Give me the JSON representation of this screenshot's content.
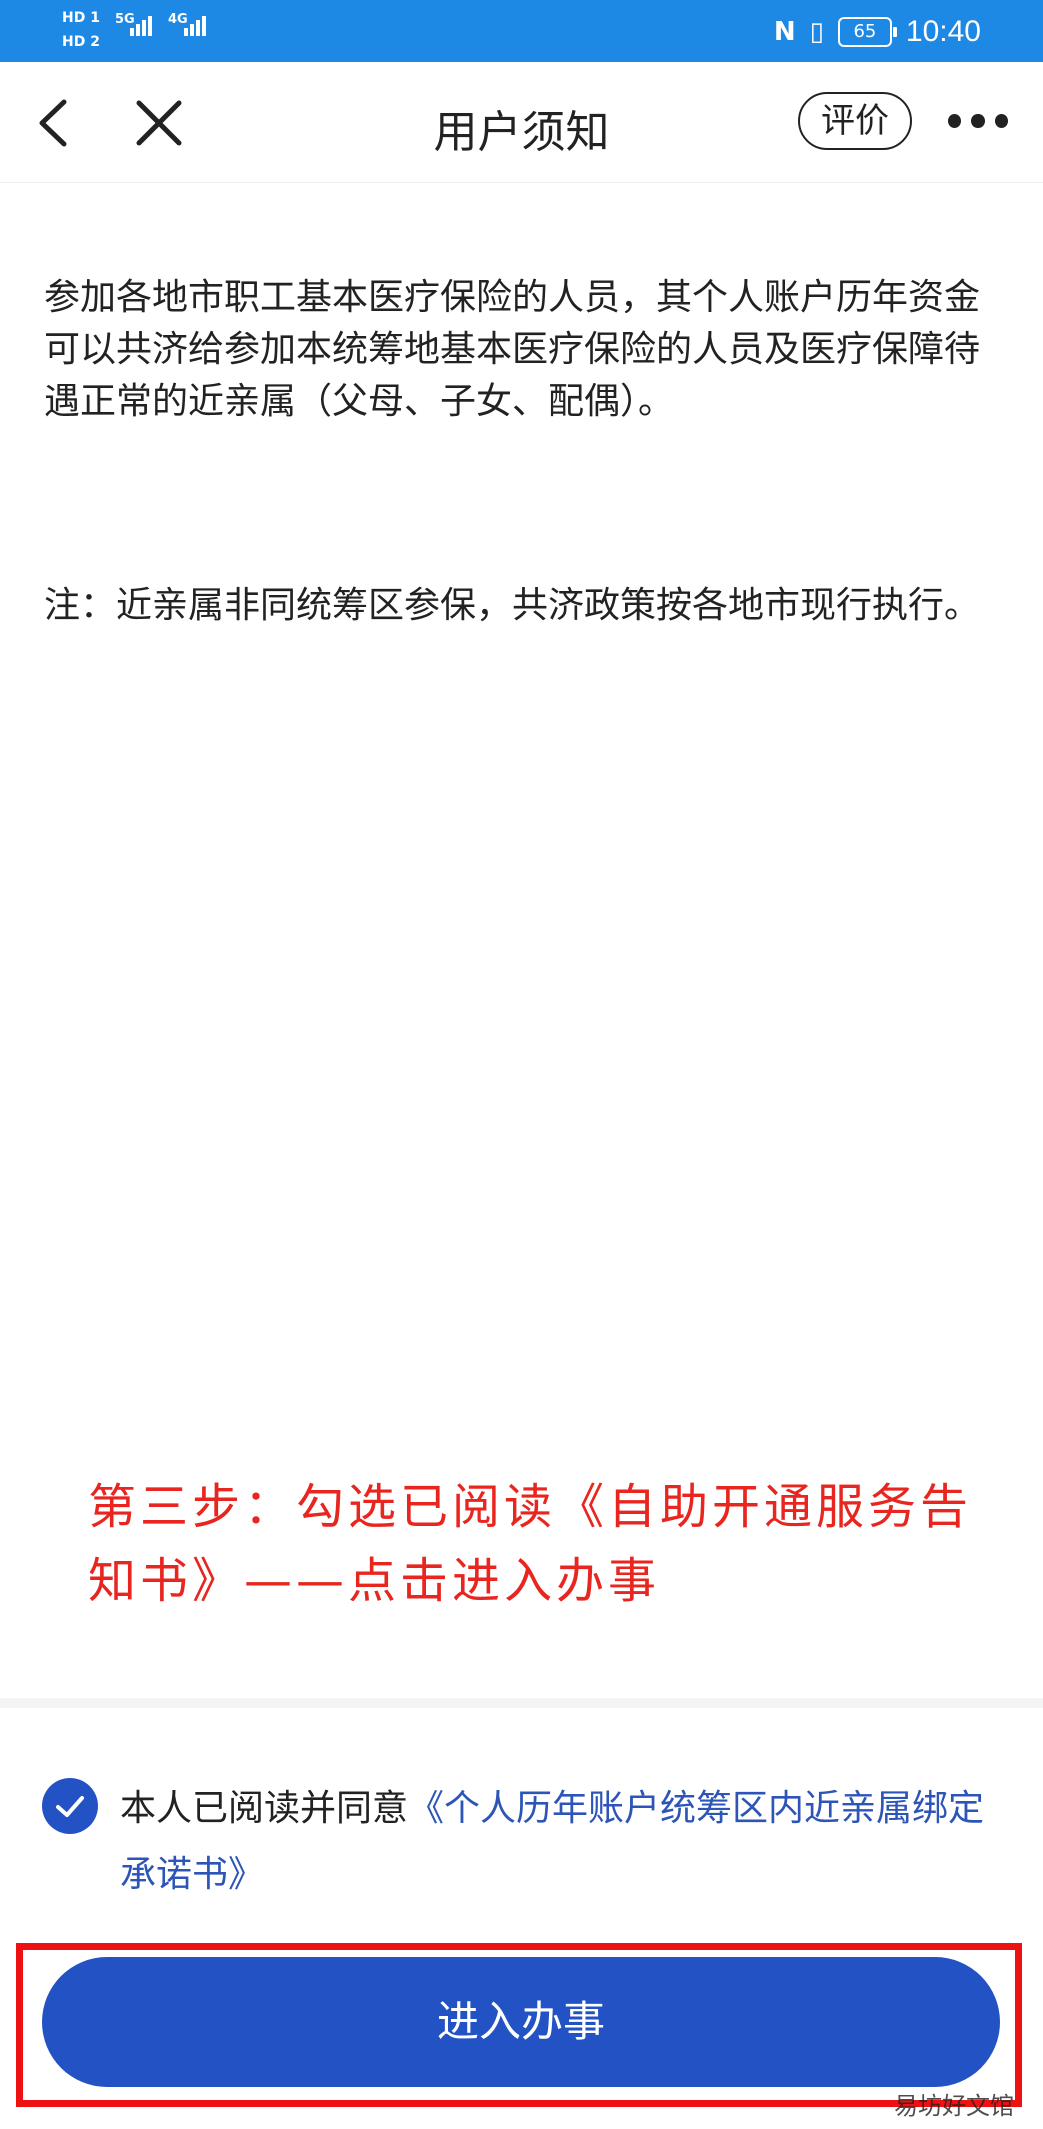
{
  "status_bar": {
    "hd1": "HD 1",
    "hd2": "HD 2",
    "net1": "5G",
    "net2": "4G",
    "nfc": "N",
    "battery": "65",
    "time": "10:40"
  },
  "nav": {
    "title": "用户须知",
    "rate_label": "评价"
  },
  "content": {
    "paragraph1": "参加各地市职工基本医疗保险的人员，其个人账户历年资金可以共济给参加本统筹地基本医疗保险的人员及医疗保障待遇正常的近亲属（父母、子女、配偶）。",
    "paragraph2": "注：近亲属非同统筹区参保，共济政策按各地市现行执行。"
  },
  "annotation": {
    "text": "第三步：勾选已阅读《自助开通服务告知书》——点击进入办事"
  },
  "agreement": {
    "checked": true,
    "prefix": "本人已阅读并同意",
    "link": "《个人历年账户统筹区内近亲属绑定承诺书》"
  },
  "enter_button": {
    "label": "进入办事"
  },
  "watermark": "易坊好文馆",
  "colors": {
    "status_bar": "#1e88e5",
    "primary_button": "#2352c4",
    "link": "#2d55b8",
    "annotation_red": "#e8251f"
  }
}
